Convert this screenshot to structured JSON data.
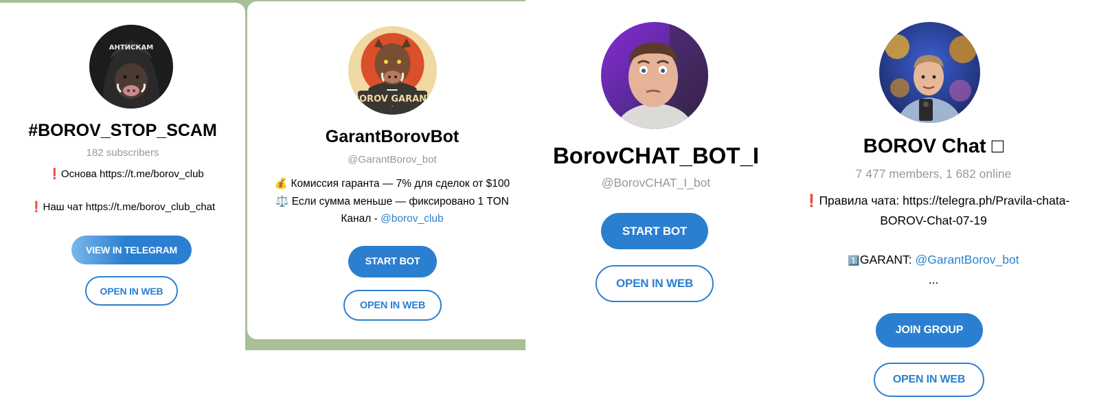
{
  "cards": [
    {
      "title": "#BOROV_STOP_SCAM",
      "subtitle": "182 subscribers",
      "avatar_text": "АНТИСКАМ",
      "desc_line1_icon": "❗",
      "desc_line1_text": "Основа https://t.me/borov_club",
      "desc_line2_icon": "❗",
      "desc_line2_text": "Наш чат https://t.me/borov_club_chat",
      "primary_button": "VIEW IN TELEGRAM",
      "secondary_button": "OPEN IN WEB"
    },
    {
      "title": "GarantBorovBot",
      "subtitle": "@GarantBorov_bot",
      "avatar_text": "BOROV GARANT",
      "desc_line1_icon": "💰",
      "desc_line1_text": "Комиссия гаранта — 7% для сделок от $100",
      "desc_line2_icon": "⚖️",
      "desc_line2_text": "Если сумма меньше — фиксировано 1 TON",
      "desc_line3_prefix": "Канал - ",
      "desc_line3_link": "@borov_club",
      "primary_button": "START BOT",
      "secondary_button": "OPEN IN WEB"
    },
    {
      "title": "BorovCHAT_BOT_I",
      "subtitle": "@BorovCHAT_I_bot",
      "primary_button": "START BOT",
      "secondary_button": "OPEN IN WEB"
    },
    {
      "title": "BOROV Chat □",
      "subtitle": "7 477 members, 1 682 online",
      "desc_line1_icon": "❗",
      "desc_line1_text": "Правила чата: https://telegra.ph/Pravila-chata-",
      "desc_line2_text": "BOROV-Chat-07-19",
      "desc_line3_icon": "1️⃣",
      "desc_line3_prefix": "GARANT: ",
      "desc_line3_link": "@GarantBorov_bot",
      "desc_line4_text": "...",
      "primary_button": "JOIN GROUP",
      "secondary_button": "OPEN IN WEB"
    }
  ],
  "colors": {
    "accent": "#2b7fd0",
    "link": "#2b84cf",
    "muted": "#999999",
    "background_green": "#a9bf95"
  },
  "icons": {
    "warning": "exclamation-icon",
    "money_bag": "money-bag-icon",
    "scales": "scales-icon",
    "keycap_one": "keycap-one-icon"
  }
}
